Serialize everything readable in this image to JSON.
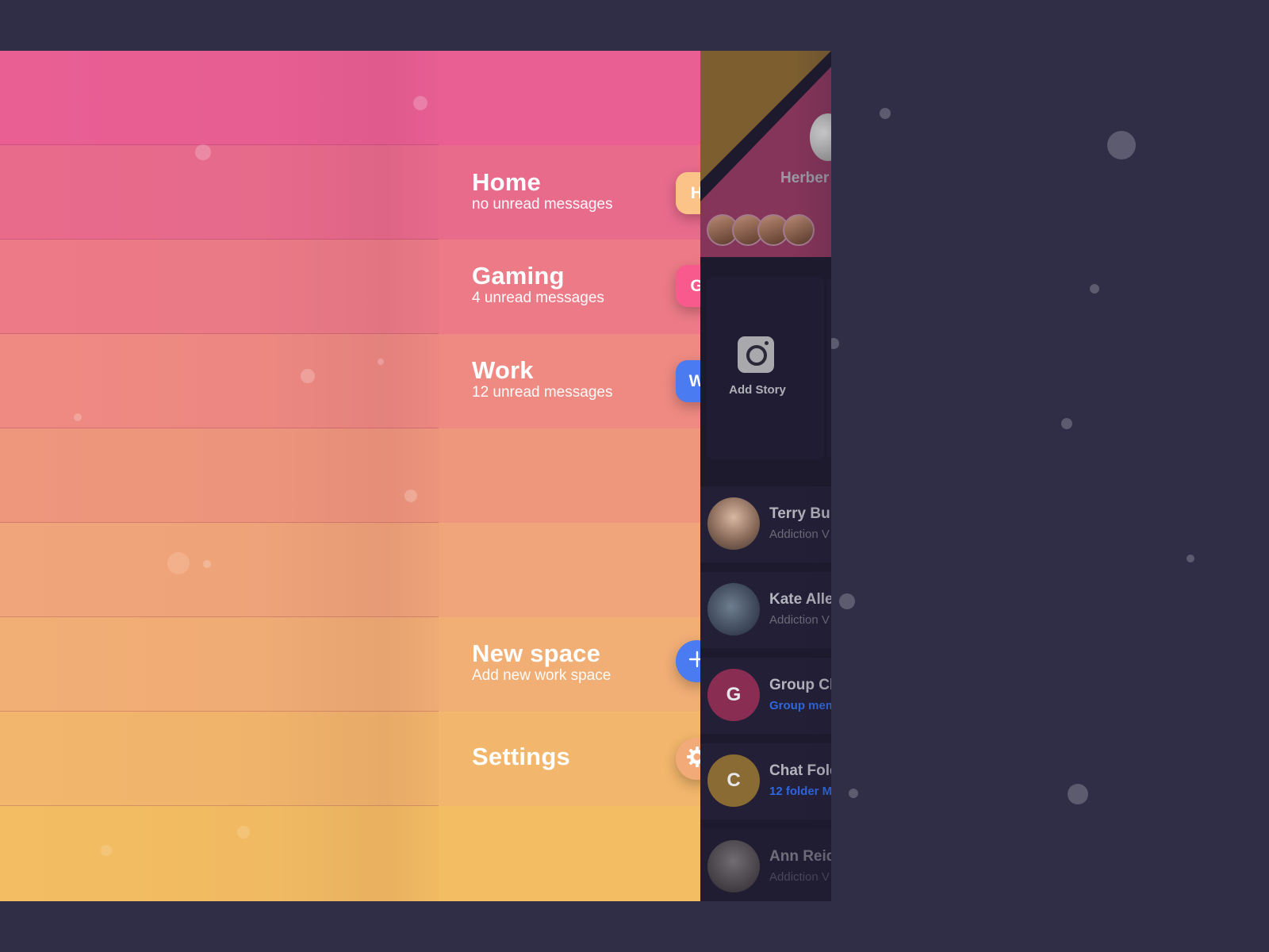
{
  "menu": {
    "colors": [
      "#e95f94",
      "#e86b8c",
      "#ec7b87",
      "#ee8a82",
      "#ef977d",
      "#f1a57a",
      "#f1ae75",
      "#f2b66c",
      "#f3bd63"
    ],
    "items": [
      {
        "title": "Home",
        "subtitle": "no unread messages",
        "badge": "H",
        "badge_color": "#fcc389"
      },
      {
        "title": "Gaming",
        "subtitle": "4 unread messages",
        "badge": "G",
        "badge_color": "#f95a8e"
      },
      {
        "title": "Work",
        "subtitle": "12 unread messages",
        "badge": "W",
        "badge_color": "#4b7bf0"
      },
      {
        "title": "New space",
        "subtitle": "Add new work space",
        "badge_icon": "plus-icon",
        "badge_color": "#4b7bf0"
      },
      {
        "title": "Settings",
        "badge_icon": "gear-icon",
        "badge_color": "#f3aa79"
      }
    ]
  },
  "panel": {
    "profile_name": "Herber",
    "add_story_label": "Add Story",
    "chats": [
      {
        "name": "Terry Bu",
        "sub": "Addiction V",
        "avatar": "photo"
      },
      {
        "name": "Kate Alle",
        "sub": "Addiction V",
        "avatar": "photo"
      },
      {
        "name": "Group Cl",
        "sub": "Group mem",
        "avatar_letter": "G",
        "avatar_color": "#8a2d52",
        "sub_style": "link"
      },
      {
        "name": "Chat Fold",
        "sub": "12 folder M",
        "avatar_letter": "C",
        "avatar_color": "#8a6b34",
        "sub_style": "link"
      },
      {
        "name": "Ann Reid",
        "sub": "Addiction V",
        "avatar": "photo"
      }
    ]
  }
}
